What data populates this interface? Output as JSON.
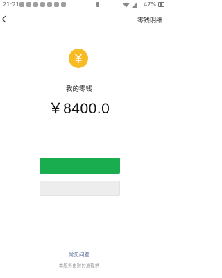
{
  "status_bar": {
    "time": "21:21",
    "battery_percent": "47%",
    "left_icons": [
      "app-notification-icon",
      "app-notification-icon",
      "app-notification-icon",
      "app-notification-icon",
      "app-notification-icon",
      "app-notification-icon",
      "app-notification-icon"
    ],
    "right_icons": [
      "signal-tag-icon",
      "wifi-icon",
      "cellular-signal-icon",
      "battery-icon"
    ]
  },
  "header": {
    "back_icon": "chevron-left-icon",
    "detail_link": "零钱明细"
  },
  "wallet": {
    "icon": "yuan-coin-icon",
    "icon_color": "#f6bb25",
    "label": "我的零钱",
    "amount": "￥8400.0"
  },
  "buttons": {
    "primary_color": "#1aad4f",
    "primary_label": "",
    "secondary_label": ""
  },
  "footer": {
    "faq_link": "常见问题",
    "service_note": "本服务由财付通提供",
    "link_color": "#576b95"
  }
}
